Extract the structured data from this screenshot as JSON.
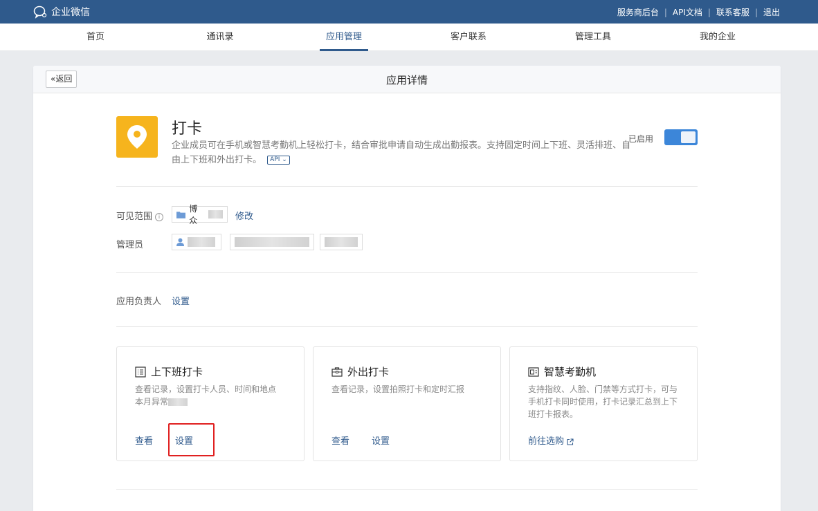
{
  "topbar": {
    "brand": "企业微信",
    "links": [
      "服务商后台",
      "API文档",
      "联系客服",
      "退出"
    ],
    "color": "#2f5a8c"
  },
  "nav": {
    "items": [
      "首页",
      "通讯录",
      "应用管理",
      "客户联系",
      "管理工具",
      "我的企业"
    ],
    "active": "应用管理"
  },
  "panel": {
    "back_label": "返回",
    "title": "应用详情"
  },
  "app": {
    "name": "打卡",
    "description": "企业成员可在手机或智慧考勤机上轻松打卡，结合审批申请自动生成出勤报表。支持固定时间上下班、灵活排班、自由上下班和外出打卡。",
    "api_tag": "API",
    "status": "已启用",
    "enabled": true,
    "icon": "location-pin-icon",
    "icon_color": "#f6b41d"
  },
  "scope": {
    "label": "可见范围",
    "department": "博众",
    "edit_label": "修改"
  },
  "admin": {
    "label": "管理员"
  },
  "owner": {
    "label": "应用负责人",
    "set_label": "设置"
  },
  "cards": [
    {
      "title": "上下班打卡",
      "icon": "list-icon",
      "desc_line1": "查看记录，设置打卡人员、时间和地点",
      "desc_line2": "本月异常",
      "link1": "查看",
      "link2": "设置"
    },
    {
      "title": "外出打卡",
      "icon": "briefcase-icon",
      "desc": "查看记录，设置拍照打卡和定时汇报",
      "link1": "查看",
      "link2": "设置"
    },
    {
      "title": "智慧考勤机",
      "icon": "device-icon",
      "desc": "支持指纹、人脸、门禁等方式打卡，可与手机打卡同时使用，打卡记录汇总到上下班打卡报表。",
      "link1": "前往选购"
    }
  ]
}
